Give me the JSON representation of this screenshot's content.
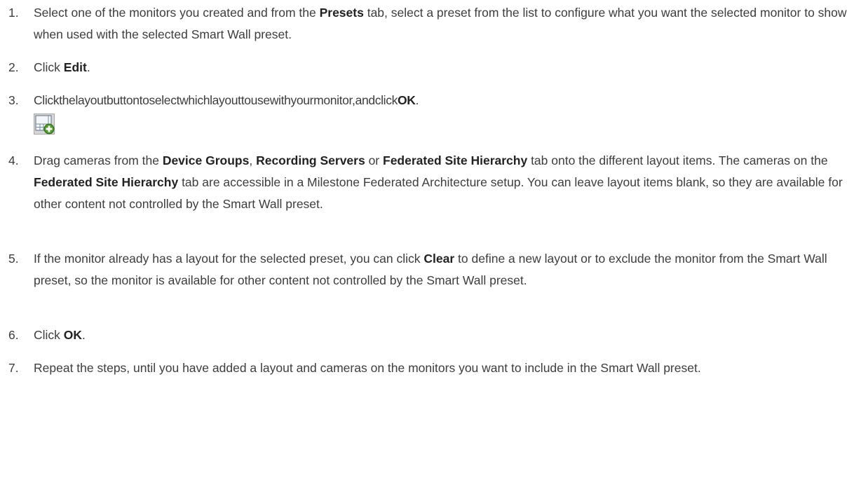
{
  "steps": [
    {
      "number": "1.",
      "parts": [
        "Select one of the monitors you created and from the ",
        "Presets",
        " tab, select a preset from the list to configure what you want the selected monitor to show when used with the selected Smart Wall preset."
      ]
    },
    {
      "number": "2.",
      "parts": [
        "Click ",
        "Edit",
        "."
      ]
    },
    {
      "number": "3.",
      "parts": [
        "Clickthelayoutbuttontoselectwhichlayouttousewithyourmonitor,andclick",
        "OK",
        "."
      ],
      "icon": "layout-add-icon"
    },
    {
      "number": "4.",
      "parts": [
        "Drag cameras from the ",
        "Device Groups",
        ", ",
        "Recording Servers",
        " or ",
        "Federated Site Hierarchy",
        " tab onto the different layout items. The cameras on the ",
        "Federated Site Hierarchy",
        " tab are accessible in a Milestone Federated Architecture setup. You can leave layout items blank, so they are available for other content not controlled by the Smart Wall preset."
      ]
    },
    {
      "number": "5.",
      "parts": [
        "If the monitor already has a layout for the selected preset, you can click ",
        "Clear",
        " to define a new layout or to exclude the monitor from the Smart Wall preset, so the monitor is available for other content not controlled by the Smart Wall preset."
      ]
    },
    {
      "number": "6.",
      "parts": [
        "Click ",
        "OK",
        "."
      ]
    },
    {
      "number": "7.",
      "parts": [
        "Repeat the steps, until you have added a layout and cameras on the monitors you want to include in the Smart Wall preset."
      ]
    }
  ]
}
